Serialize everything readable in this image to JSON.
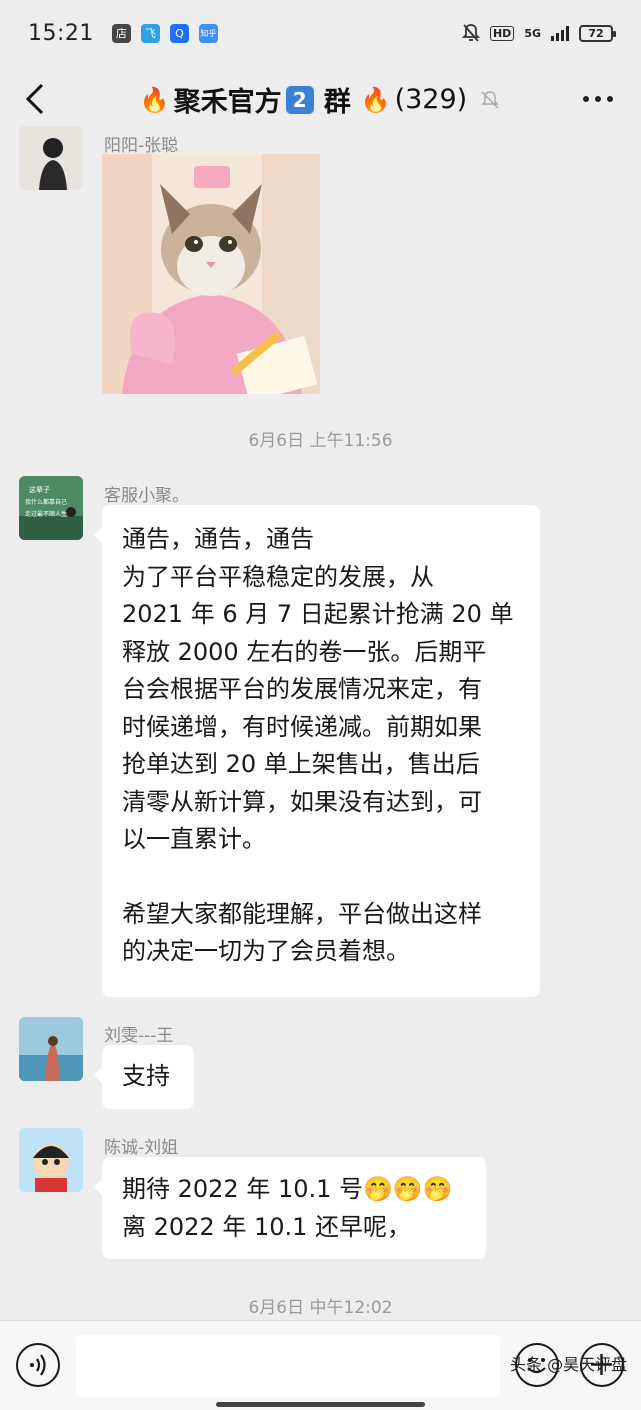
{
  "status_bar": {
    "time": "15:21",
    "app_icons": [
      "店",
      "飞",
      "Q",
      "知乎"
    ],
    "hd": "HD",
    "network": "5G",
    "battery": "72"
  },
  "nav": {
    "title": "聚禾官方",
    "group_num": "2",
    "suffix": "群",
    "count": "(329)",
    "fire": "🔥"
  },
  "messages": [
    {
      "sender": "阳阳-张聪",
      "type": "image",
      "image_desc": "cat-in-nurse-costume"
    },
    {
      "timestamp": "6月6日 上午11:56"
    },
    {
      "sender": "客服小聚。",
      "avatar_text": "这辈子 我什么都靠自己 走过最不顺人生",
      "lines": [
        "通告，通告，通告",
        "为了平台平稳稳定的发展，从",
        "2021 年 6 月 7 日起累计抢满 20 单",
        "释放 2000 左右的卷一张。后期平",
        "台会根据平台的发展情况来定，有",
        "时候递增，有时候递减。前期如果",
        "抢单达到 20 单上架售出，售出后",
        "清零从新计算，如果没有达到，可",
        "以一直累计。",
        "",
        "希望大家都能理解，平台做出这样",
        "的决定一切为了会员着想。"
      ]
    },
    {
      "sender": "刘雯---王",
      "lines": [
        "支持"
      ]
    },
    {
      "sender": "陈诚-刘姐",
      "lines": [
        "期待 2022 年 10.1 号🤭🤭🤭",
        "离 2022 年 10.1 还早呢，"
      ]
    },
    {
      "timestamp2": "6月6日 中午12:02"
    }
  ],
  "watermark": "头条 @昊天评盘"
}
